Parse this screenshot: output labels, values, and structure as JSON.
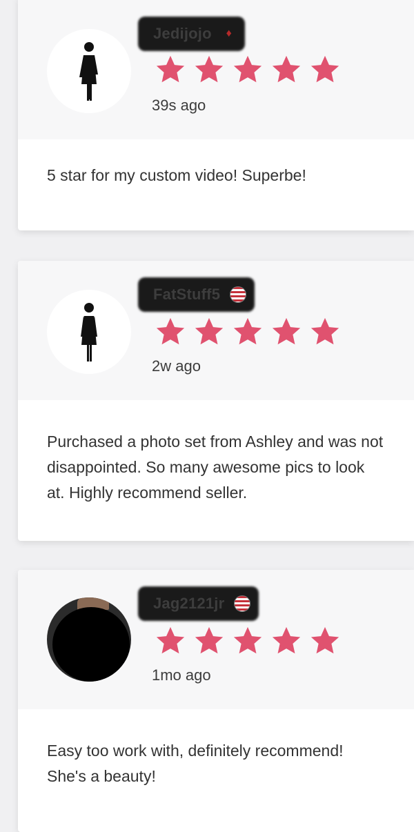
{
  "reviews": [
    {
      "username": "Jedijojo",
      "flag": "canada-flag",
      "avatar": "person-icon",
      "rating": 5,
      "time": "39s ago",
      "text": "5 star for my custom video! Superbe!"
    },
    {
      "username": "FatStuff5",
      "flag": "usa-flag",
      "avatar": "person-icon",
      "rating": 5,
      "time": "2w ago",
      "text": "Purchased a photo set from Ashley and was not disappointed. So many awesome pics to look at. Highly recommend seller."
    },
    {
      "username": "Jag2121jr",
      "flag": "usa-flag",
      "avatar": "user-photo",
      "rating": 5,
      "time": "1mo ago",
      "text": "Easy too work with, definitely recommend! She's a beauty!"
    }
  ],
  "colors": {
    "star": "#e0526f",
    "header_bg": "#f7f7f8",
    "card_bg": "#ffffff",
    "page_bg": "#f0f0f2"
  }
}
